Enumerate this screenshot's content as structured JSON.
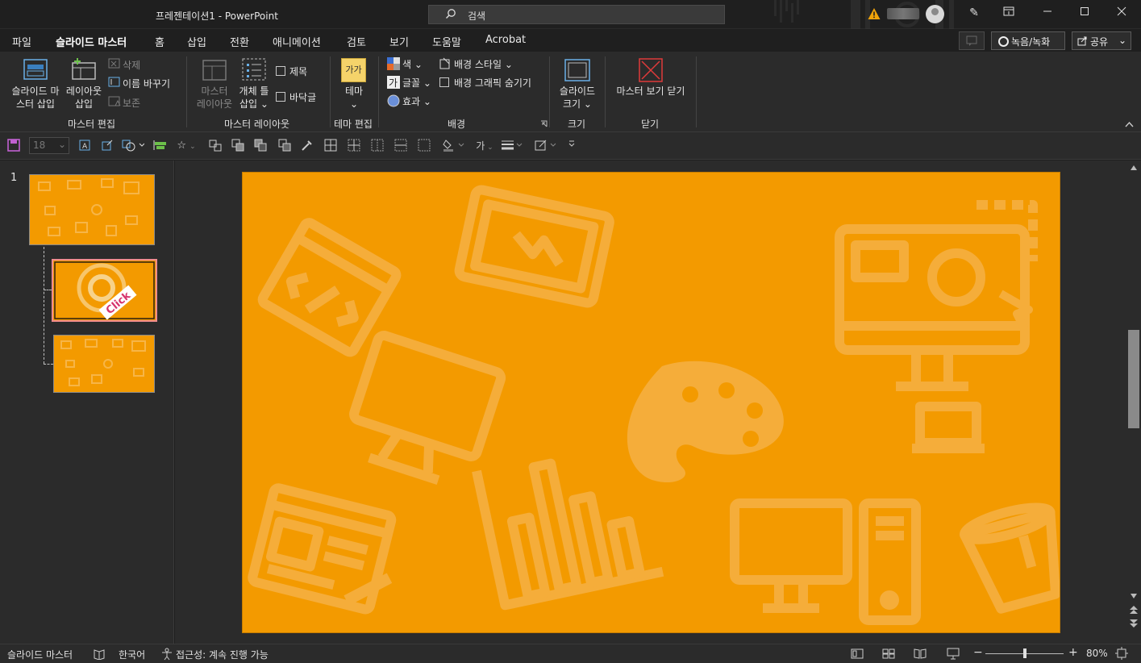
{
  "window": {
    "title": "프레젠테이션1  -  PowerPoint"
  },
  "search": {
    "placeholder": "검색"
  },
  "menu": {
    "tabs": [
      "파일",
      "슬라이드 마스터",
      "홈",
      "삽입",
      "전환",
      "애니메이션",
      "검토",
      "보기",
      "도움말",
      "Acrobat"
    ],
    "active": "슬라이드 마스터",
    "record_label": "녹음/녹화",
    "share_label": "공유"
  },
  "ribbon": {
    "insert_slide_master": [
      "슬라이드 마",
      "스터 삽입"
    ],
    "insert_layout": [
      "레이아웃",
      "삽입"
    ],
    "delete": "삭제",
    "rename": "이름 바꾸기",
    "preserve": "보존",
    "group_edit_master": "마스터 편집",
    "master_layout": [
      "마스터",
      "레이아웃"
    ],
    "insert_placeholder": [
      "개체 틀",
      "삽입"
    ],
    "title_check": "제목",
    "footer_check": "바닥글",
    "group_master_layout": "마스터 레이아웃",
    "themes_icon_text": "가가",
    "themes": "테마",
    "group_edit_theme": "테마 편집",
    "colors": "색",
    "fonts": "글꼴",
    "effects": "효과",
    "bg_styles": "배경 스타일",
    "hide_bg_graphics": "배경 그래픽 숨기기",
    "group_background": "배경",
    "slide_size": [
      "슬라이드",
      "크기"
    ],
    "group_size": "크기",
    "close_master": "마스터 보기 닫기",
    "group_close": "닫기"
  },
  "qat": {
    "font_size": "18"
  },
  "thumbnails": {
    "number": "1",
    "badge_text": "Click"
  },
  "status": {
    "view": "슬라이드 마스터",
    "language": "한국어",
    "accessibility": "접근성: 계속 진행 가능",
    "zoom_minus": "−",
    "zoom_plus": "+",
    "zoom": "80%",
    "zoom_fraction": 0.5
  },
  "colors": {
    "slide": "#f39a00",
    "accent_pink": "#d6336c"
  }
}
